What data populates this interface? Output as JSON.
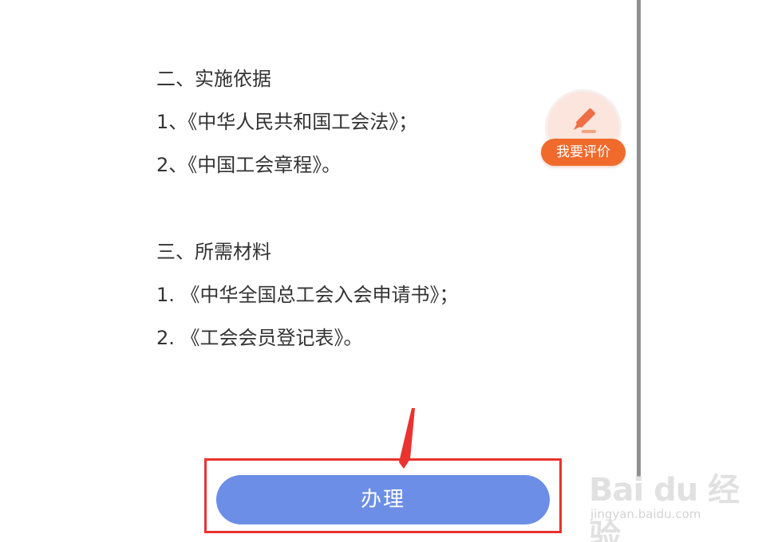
{
  "content": {
    "section2_title": "二、实施依据",
    "section2_items": [
      "1、《中华人民共和国工会法》；",
      "2、《中国工会章程》。"
    ],
    "section3_title": "三、所需材料",
    "section3_items": [
      "1. 《中华全国总工会入会申请书》；",
      "2. 《工会会员登记表》。"
    ]
  },
  "rate_widget": {
    "label": "我要评价",
    "icon": "pencil-icon",
    "color": "#f06a2c"
  },
  "action": {
    "submit_label": "办理",
    "button_color": "#6c8ee6",
    "highlight_color": "#e8332f"
  },
  "watermark": {
    "brand": "Bai du 经验",
    "url": "jingyan.baidu.com"
  }
}
